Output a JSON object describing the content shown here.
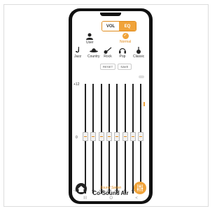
{
  "tabs": {
    "vol": "VOL",
    "eq": "EQ"
  },
  "presets_row1": [
    {
      "label": "User",
      "icon": "user-icon"
    },
    {
      "label": "Normal",
      "icon": "check-icon",
      "active": true
    }
  ],
  "presets_row2": [
    {
      "label": "Jazz",
      "icon": "saxophone-icon"
    },
    {
      "label": "Country",
      "icon": "cowboy-hat-icon"
    },
    {
      "label": "Rock",
      "icon": "guitar-icon"
    },
    {
      "label": "Pop",
      "icon": "headphones-icon"
    },
    {
      "label": "Classic",
      "icon": "violin-icon"
    }
  ],
  "buttons": {
    "reset": "RESET",
    "save": "SAVE"
  },
  "scale": {
    "top": "+12",
    "mid": "0",
    "bottom": "-12"
  },
  "bands": [
    {
      "freq": "31",
      "level": 0
    },
    {
      "freq": "62",
      "level": 0
    },
    {
      "freq": "125",
      "level": 0
    },
    {
      "freq": "250",
      "level": 0
    },
    {
      "freq": "500",
      "level": 0
    },
    {
      "freq": "1k",
      "level": 0
    },
    {
      "freq": "8k",
      "level": 0
    },
    {
      "freq": "16k",
      "level": 0
    }
  ],
  "brand": {
    "sub": "Sound Sation",
    "main": "Co-Sound Air"
  },
  "nav": {
    "recent": "III",
    "home": "O",
    "back": "<"
  },
  "colors": {
    "accent": "#f0a33a",
    "dark": "#222222"
  }
}
